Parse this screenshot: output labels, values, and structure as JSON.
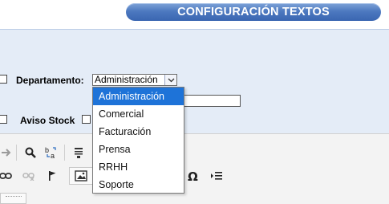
{
  "header": {
    "title": "CONFIGURACIÓN TEXTOS"
  },
  "form": {
    "departamento_label": "Departamento:",
    "departamento_value": "Administración",
    "aviso_stock_label": "Aviso Stock"
  },
  "dropdown": {
    "options": [
      "Administración",
      "Comercial",
      "Facturación",
      "Prensa",
      "RRHH",
      "Soporte"
    ],
    "selected": "Administración"
  },
  "toolbar": {
    "icons": [
      "redo-icon",
      "find-icon",
      "replace-icon",
      "source-icon",
      "link-icon",
      "unlink-icon",
      "anchor-icon",
      "image-icon",
      "special-char-icon",
      "indent-icon"
    ]
  },
  "colors": {
    "header_pill": "#4d79c0",
    "panel_bg": "#e4ecf7",
    "selected_option": "#1e73d8"
  }
}
